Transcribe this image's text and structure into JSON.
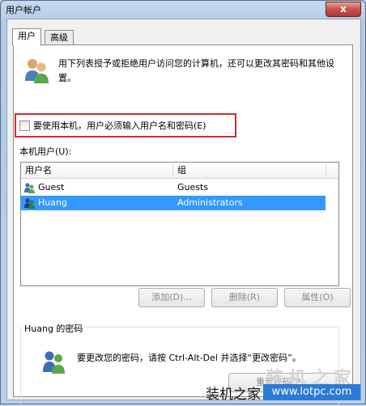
{
  "window": {
    "title": "用户帐户",
    "close_label": "x"
  },
  "tabs": [
    {
      "label": "用户",
      "active": true
    },
    {
      "label": "高级",
      "active": false
    }
  ],
  "intro_text": "用下列表授予或拒绝用户访问您的计算机，还可以更改其密码和其他设置。",
  "must_login_checkbox": {
    "label": "要使用本机，用户必须输入用户名和密码(E)",
    "checked": false
  },
  "users_label": "本机用户(U):",
  "user_table": {
    "columns": [
      "用户名",
      "组"
    ],
    "rows": [
      {
        "name": "Guest",
        "group": "Guests",
        "selected": false
      },
      {
        "name": "Huang",
        "group": "Administrators",
        "selected": true
      }
    ]
  },
  "buttons": {
    "add": "添加(D)...",
    "delete": "删除(R)",
    "properties": "属性(O)"
  },
  "password_group": {
    "title": "Huang 的密码",
    "text": "要更改您的密码，请按 Ctrl-Alt-Del 并选择“更改密码”。",
    "reset_button": "重置密码(P)..."
  },
  "watermark": {
    "brand": "装机之家",
    "big": "装机之家",
    "url": "www.lotpc.com"
  },
  "colors": {
    "selection": "#3399ff",
    "highlight_box": "#d52b2b",
    "watermark_url_bg": "#2c7ad6"
  }
}
